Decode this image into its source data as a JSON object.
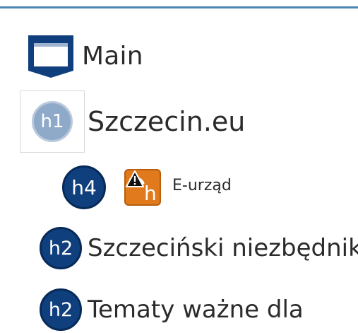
{
  "tree": {
    "main": {
      "label": "Main",
      "icon": "page-window-icon"
    },
    "site": {
      "label": "Szczecin.eu",
      "badge": "h1",
      "selected": true
    },
    "eurzad": {
      "badge": "h4",
      "icon": "external-link-shortcut-icon",
      "warning_icon": "warning-triangle-icon",
      "label": "E-urząd"
    },
    "niezbednik": {
      "badge": "h2",
      "label": "Szczeciński niezbędnik"
    },
    "tematy": {
      "badge": "h2",
      "label": "Tematy ważne dla"
    }
  },
  "colors": {
    "accent_rule": "#4a86b4",
    "badge_dark": "#0f3f7d",
    "badge_h1": "#8fa9c9",
    "shortcut_orange": "#e07a1c"
  }
}
